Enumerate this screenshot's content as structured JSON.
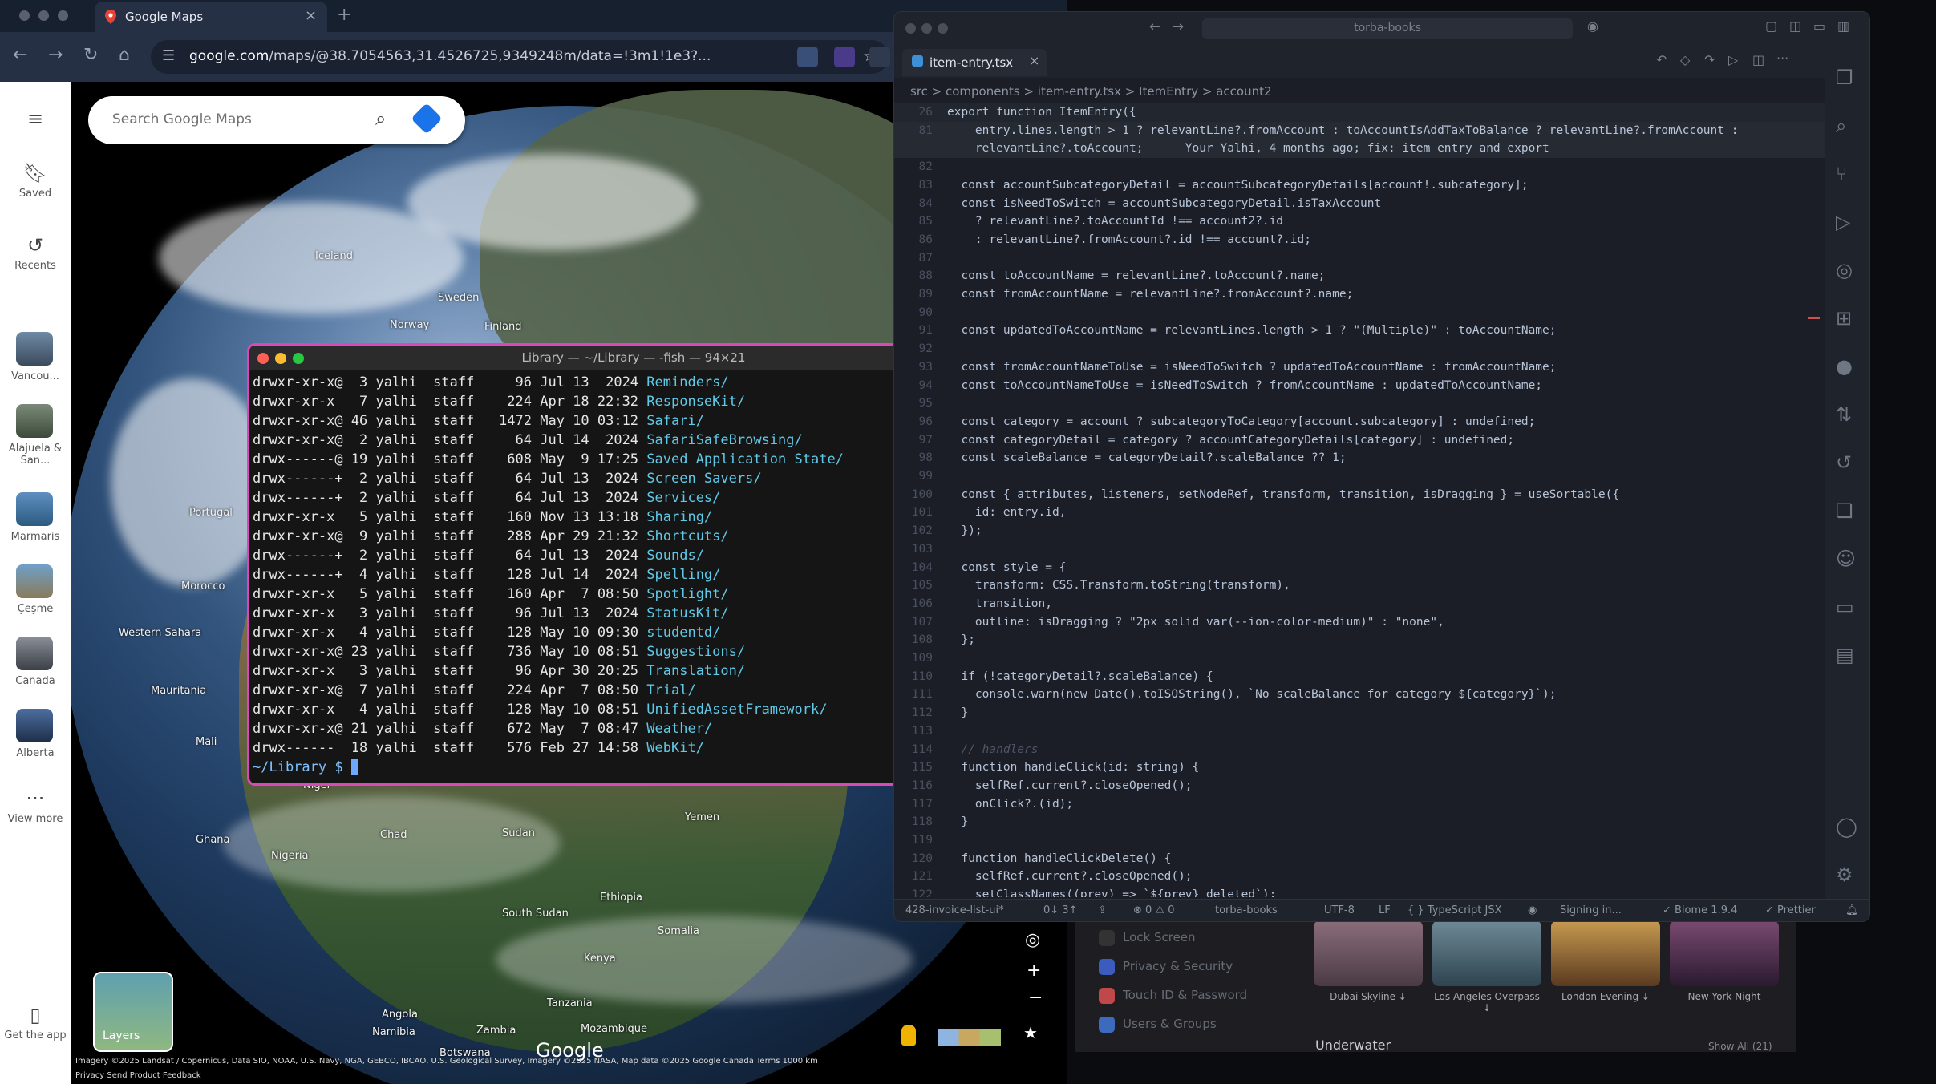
{
  "browser": {
    "tab_title": "Google Maps",
    "tab_close": "×",
    "new_tab": "+",
    "url_host": "google.com",
    "url_path": "/maps/@38.7054563,31.4526725,9349248m/data=!3m1!1e3?...",
    "nav": {
      "back": "←",
      "forward": "→",
      "reload": "↻",
      "home": "⌂"
    }
  },
  "maps": {
    "search_placeholder": "Search Google Maps",
    "rail": {
      "menu": "≡",
      "saved": "Saved",
      "recents": "Recents",
      "recent_places": [
        "Vancou...",
        "Alajuela & San...",
        "Marmaris",
        "Çeşme",
        "Canada",
        "Alberta"
      ],
      "view_more": "View more",
      "get_app": "Get the app"
    },
    "places": [
      "Iceland",
      "Sweden",
      "Norway",
      "Finland",
      "Portugal",
      "Morocco",
      "Western Sahara",
      "Mauritania",
      "Mali",
      "Niger",
      "Chad",
      "Sudan",
      "Yemen",
      "Nigeria",
      "Ghana",
      "Ethiopia",
      "South Sudan",
      "Somalia",
      "Kenya",
      "Tanzania",
      "Angola",
      "Zambia",
      "Namibia",
      "Botswana",
      "Mozambique"
    ],
    "layers_label": "Layers",
    "logo": "Google",
    "attribution": "Imagery ©2025 Landsat / Copernicus, Data SIO, NOAA, U.S. Navy, NGA, GEBCO, IBCAO, U.S. Geological Survey, Imagery ©2025 NASA, Map data ©2025 Google    Canada    Terms    1000 km",
    "attribution2": "Privacy    Send Product Feedback"
  },
  "terminal": {
    "title": "Library — ~/Library — -fish — 94×21",
    "rows": [
      {
        "perm": "drwxr-xr-x@",
        "n": "3",
        "user": "yalhi",
        "grp": "staff",
        "size": "96",
        "mon": "Jul",
        "day": "13",
        "time": " 2024",
        "name": "Reminders/"
      },
      {
        "perm": "drwxr-xr-x ",
        "n": "7",
        "user": "yalhi",
        "grp": "staff",
        "size": "224",
        "mon": "Apr",
        "day": "18",
        "time": "22:32",
        "name": "ResponseKit/"
      },
      {
        "perm": "drwxr-xr-x@",
        "n": "46",
        "user": "yalhi",
        "grp": "staff",
        "size": "1472",
        "mon": "May",
        "day": "10",
        "time": "03:12",
        "name": "Safari/"
      },
      {
        "perm": "drwxr-xr-x@",
        "n": "2",
        "user": "yalhi",
        "grp": "staff",
        "size": "64",
        "mon": "Jul",
        "day": "14",
        "time": " 2024",
        "name": "SafariSafeBrowsing/"
      },
      {
        "perm": "drwx------@",
        "n": "19",
        "user": "yalhi",
        "grp": "staff",
        "size": "608",
        "mon": "May",
        "day": " 9",
        "time": "17:25",
        "name": "Saved Application State/"
      },
      {
        "perm": "drwx------+",
        "n": "2",
        "user": "yalhi",
        "grp": "staff",
        "size": "64",
        "mon": "Jul",
        "day": "13",
        "time": " 2024",
        "name": "Screen Savers/"
      },
      {
        "perm": "drwx------+",
        "n": "2",
        "user": "yalhi",
        "grp": "staff",
        "size": "64",
        "mon": "Jul",
        "day": "13",
        "time": " 2024",
        "name": "Services/"
      },
      {
        "perm": "drwxr-xr-x ",
        "n": "5",
        "user": "yalhi",
        "grp": "staff",
        "size": "160",
        "mon": "Nov",
        "day": "13",
        "time": "13:18",
        "name": "Sharing/"
      },
      {
        "perm": "drwxr-xr-x@",
        "n": "9",
        "user": "yalhi",
        "grp": "staff",
        "size": "288",
        "mon": "Apr",
        "day": "29",
        "time": "21:32",
        "name": "Shortcuts/"
      },
      {
        "perm": "drwx------+",
        "n": "2",
        "user": "yalhi",
        "grp": "staff",
        "size": "64",
        "mon": "Jul",
        "day": "13",
        "time": " 2024",
        "name": "Sounds/"
      },
      {
        "perm": "drwx------+",
        "n": "4",
        "user": "yalhi",
        "grp": "staff",
        "size": "128",
        "mon": "Jul",
        "day": "14",
        "time": " 2024",
        "name": "Spelling/"
      },
      {
        "perm": "drwxr-xr-x ",
        "n": "5",
        "user": "yalhi",
        "grp": "staff",
        "size": "160",
        "mon": "Apr",
        "day": " 7",
        "time": "08:50",
        "name": "Spotlight/"
      },
      {
        "perm": "drwxr-xr-x ",
        "n": "3",
        "user": "yalhi",
        "grp": "staff",
        "size": "96",
        "mon": "Jul",
        "day": "13",
        "time": " 2024",
        "name": "StatusKit/"
      },
      {
        "perm": "drwxr-xr-x ",
        "n": "4",
        "user": "yalhi",
        "grp": "staff",
        "size": "128",
        "mon": "May",
        "day": "10",
        "time": "09:30",
        "name": "studentd/"
      },
      {
        "perm": "drwxr-xr-x@",
        "n": "23",
        "user": "yalhi",
        "grp": "staff",
        "size": "736",
        "mon": "May",
        "day": "10",
        "time": "08:51",
        "name": "Suggestions/"
      },
      {
        "perm": "drwxr-xr-x ",
        "n": "3",
        "user": "yalhi",
        "grp": "staff",
        "size": "96",
        "mon": "Apr",
        "day": "30",
        "time": "20:25",
        "name": "Translation/"
      },
      {
        "perm": "drwxr-xr-x@",
        "n": "7",
        "user": "yalhi",
        "grp": "staff",
        "size": "224",
        "mon": "Apr",
        "day": " 7",
        "time": "08:50",
        "name": "Trial/"
      },
      {
        "perm": "drwxr-xr-x ",
        "n": "4",
        "user": "yalhi",
        "grp": "staff",
        "size": "128",
        "mon": "May",
        "day": "10",
        "time": "08:51",
        "name": "UnifiedAssetFramework/"
      },
      {
        "perm": "drwxr-xr-x@",
        "n": "21",
        "user": "yalhi",
        "grp": "staff",
        "size": "672",
        "mon": "May",
        "day": " 7",
        "time": "08:47",
        "name": "Weather/"
      },
      {
        "perm": "drwx------ ",
        "n": "18",
        "user": "yalhi",
        "grp": "staff",
        "size": "576",
        "mon": "Feb",
        "day": "27",
        "time": "14:58",
        "name": "WebKit/"
      }
    ],
    "prompt": "~/Library $ "
  },
  "vscode": {
    "search": "torba-books",
    "tab": "item-entry.tsx",
    "tab_close": "×",
    "breadcrumbs": "src  >  components  >  item-entry.tsx  >  ItemEntry  >  account2",
    "lines": [
      {
        "ln": "26",
        "text": "export function ItemEntry({",
        "cls": "sticky"
      },
      {
        "ln": "81",
        "text": "    entry.lines.length > 1 ? relevantLine?.fromAccount : toAccountIsAddTaxToBalance ? relevantLine?.fromAccount :",
        "cls": "hl"
      },
      {
        "ln": "",
        "text": "    relevantLine?.toAccount;      Your Yalhi, 4 months ago; fix: item entry and export",
        "cls": "hl"
      },
      {
        "ln": "82",
        "text": "",
        "cls": ""
      },
      {
        "ln": "83",
        "text": "  const accountSubcategoryDetail = accountSubcategoryDetails[account!.subcategory];",
        "cls": ""
      },
      {
        "ln": "84",
        "text": "  const isNeedToSwitch = accountSubcategoryDetail.isTaxAccount",
        "cls": ""
      },
      {
        "ln": "85",
        "text": "    ? relevantLine?.toAccountId !== account2?.id",
        "cls": ""
      },
      {
        "ln": "86",
        "text": "    : relevantLine?.fromAccount?.id !== account?.id;",
        "cls": ""
      },
      {
        "ln": "87",
        "text": "",
        "cls": ""
      },
      {
        "ln": "88",
        "text": "  const toAccountName = relevantLine?.toAccount?.name;",
        "cls": ""
      },
      {
        "ln": "89",
        "text": "  const fromAccountName = relevantLine?.fromAccount?.name;",
        "cls": ""
      },
      {
        "ln": "90",
        "text": "",
        "cls": ""
      },
      {
        "ln": "91",
        "text": "  const updatedToAccountName = relevantLines.length > 1 ? \"(Multiple)\" : toAccountName;",
        "cls": ""
      },
      {
        "ln": "92",
        "text": "",
        "cls": ""
      },
      {
        "ln": "93",
        "text": "  const fromAccountNameToUse = isNeedToSwitch ? updatedToAccountName : fromAccountName;",
        "cls": ""
      },
      {
        "ln": "94",
        "text": "  const toAccountNameToUse = isNeedToSwitch ? fromAccountName : updatedToAccountName;",
        "cls": ""
      },
      {
        "ln": "95",
        "text": "",
        "cls": ""
      },
      {
        "ln": "96",
        "text": "  const category = account ? subcategoryToCategory[account.subcategory] : undefined;",
        "cls": ""
      },
      {
        "ln": "97",
        "text": "  const categoryDetail = category ? accountCategoryDetails[category] : undefined;",
        "cls": ""
      },
      {
        "ln": "98",
        "text": "  const scaleBalance = categoryDetail?.scaleBalance ?? 1;",
        "cls": ""
      },
      {
        "ln": "99",
        "text": "",
        "cls": ""
      },
      {
        "ln": "100",
        "text": "  const { attributes, listeners, setNodeRef, transform, transition, isDragging } = useSortable({",
        "cls": ""
      },
      {
        "ln": "101",
        "text": "    id: entry.id,",
        "cls": ""
      },
      {
        "ln": "102",
        "text": "  });",
        "cls": ""
      },
      {
        "ln": "103",
        "text": "",
        "cls": ""
      },
      {
        "ln": "104",
        "text": "  const style = {",
        "cls": ""
      },
      {
        "ln": "105",
        "text": "    transform: CSS.Transform.toString(transform),",
        "cls": ""
      },
      {
        "ln": "106",
        "text": "    transition,",
        "cls": ""
      },
      {
        "ln": "107",
        "text": "    outline: isDragging ? \"2px solid var(--ion-color-medium)\" : \"none\",",
        "cls": ""
      },
      {
        "ln": "108",
        "text": "  };",
        "cls": ""
      },
      {
        "ln": "109",
        "text": "",
        "cls": ""
      },
      {
        "ln": "110",
        "text": "  if (!categoryDetail?.scaleBalance) {",
        "cls": ""
      },
      {
        "ln": "111",
        "text": "    console.warn(new Date().toISOString(), `No scaleBalance for category ${category}`);",
        "cls": ""
      },
      {
        "ln": "112",
        "text": "  }",
        "cls": ""
      },
      {
        "ln": "113",
        "text": "",
        "cls": ""
      },
      {
        "ln": "114",
        "text": "  // handlers",
        "cls": ""
      },
      {
        "ln": "115",
        "text": "  function handleClick(id: string) {",
        "cls": ""
      },
      {
        "ln": "116",
        "text": "    selfRef.current?.closeOpened();",
        "cls": ""
      },
      {
        "ln": "117",
        "text": "    onClick?.(id);",
        "cls": ""
      },
      {
        "ln": "118",
        "text": "  }",
        "cls": ""
      },
      {
        "ln": "119",
        "text": "",
        "cls": ""
      },
      {
        "ln": "120",
        "text": "  function handleClickDelete() {",
        "cls": ""
      },
      {
        "ln": "121",
        "text": "    selfRef.current?.closeOpened();",
        "cls": ""
      },
      {
        "ln": "122",
        "text": "    setClassNames((prev) => `${prev} deleted`);",
        "cls": ""
      }
    ],
    "status": {
      "branch": "428-invoice-list-ui*",
      "sync": "0↓ 3↑",
      "problems": "⊗ 0 ⚠ 0",
      "folder": "torba-books",
      "encoding": "UTF-8",
      "eol": "LF",
      "language": "{ } TypeScript JSX",
      "signing": "Signing in...",
      "biome": "✓ Biome 1.9.4",
      "prettier": "✓ Prettier"
    }
  },
  "settings": {
    "items": [
      "Lock Screen",
      "Privacy & Security",
      "Touch ID & Password",
      "Users & Groups"
    ],
    "wallpapers": [
      "Dubai Skyline ↓",
      "Los Angeles Overpass ↓",
      "London Evening ↓",
      "New York Night"
    ],
    "section": "Underwater",
    "show_all": "Show All (21)"
  }
}
